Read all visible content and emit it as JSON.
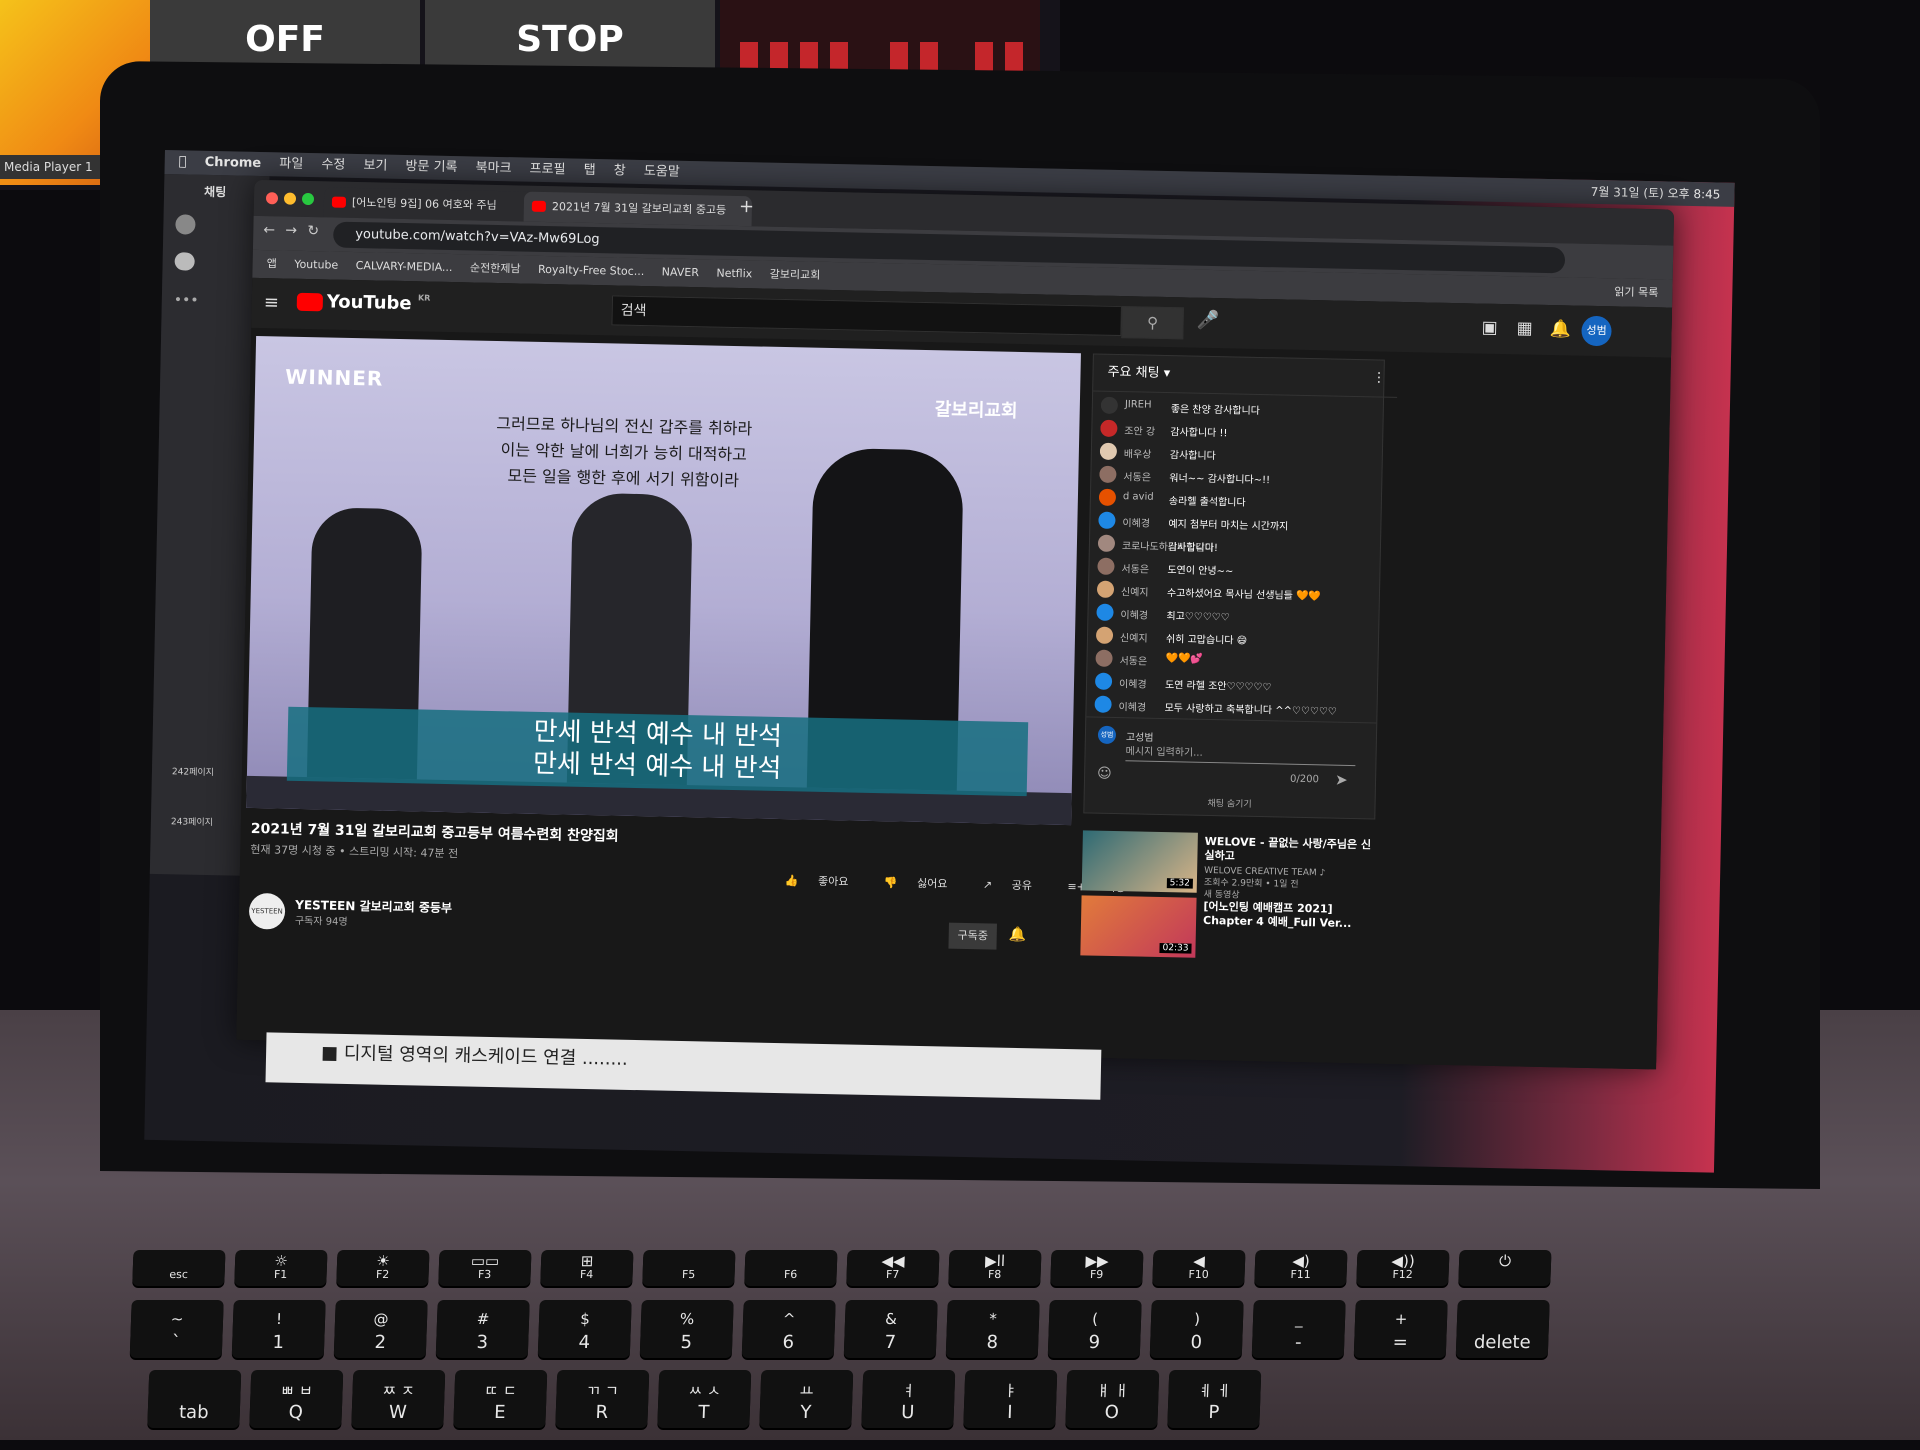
{
  "background": {
    "monitor_tiles": [
      {
        "label": "OFF"
      },
      {
        "label": "STOP"
      }
    ],
    "media_player_label": "Media Player 1"
  },
  "mac_menubar": {
    "app": "Chrome",
    "menus": [
      "파일",
      "수정",
      "보기",
      "방문 기록",
      "북마크",
      "프로필",
      "탭",
      "창",
      "도움말"
    ],
    "datetime": "7월 31일 (토) 오후 8:45"
  },
  "messenger": {
    "title": "채팅",
    "doc_items": [
      "242페이지",
      "243페이지"
    ]
  },
  "chrome": {
    "tabs": [
      {
        "title": "[어노인팅 9집] 06 여호와 주님"
      },
      {
        "title": "2021년 7월 31일 갈보리교회 중고등"
      }
    ],
    "new_tab": "+",
    "url": "youtube.com/watch?v=VAz-Mw69Log",
    "bookmarks": [
      "앱",
      "Youtube",
      "CALVARY-MEDIA...",
      "순전한제남",
      "Royalty-Free Stoc...",
      "NAVER",
      "Netflix",
      "갈보리교회"
    ],
    "reading_list": "읽기 목록"
  },
  "youtube": {
    "logo": "YouTube",
    "region": "KR",
    "search_placeholder": "검색",
    "user_initial": "성범",
    "video": {
      "overlay_logo": "WINNER",
      "church_logo": "갈보리교회",
      "verse_lines": [
        "그러므로 하나님의 전신 갑주를 취하라",
        "이는 악한 날에 너희가 능히 대적하고",
        "모든 일을 행한 후에 서기 위함이라"
      ],
      "lyric_lines": [
        "만세 반석 예수 내 반석",
        "만세 반석 예수 내 반석"
      ]
    },
    "title": "2021년 7월 31일 갈보리교회 중고등부 여름수련회 찬양집회",
    "meta": "현재 37명 시청 중 • 스트리밍 시작: 47분 전",
    "actions": [
      "좋아요",
      "싫어요",
      "공유",
      "저장"
    ],
    "channel": {
      "name": "YESTEEN 갈보리교회 중등부",
      "subscribers": "구독자 94명",
      "avatar_text": "YESTEEN",
      "subscribed_label": "구독중"
    },
    "chat": {
      "header": "주요 채팅",
      "messages": [
        {
          "name": "JIREH",
          "text": "좋은 찬양 감사합니다",
          "color": "#333333"
        },
        {
          "name": "조안 강",
          "text": "감사합니다 !!",
          "color": "#c62828"
        },
        {
          "name": "배우상",
          "text": "감사합니다",
          "color": "#e0c9b0"
        },
        {
          "name": "서동은",
          "text": "워너~~ 감사합니다~!!",
          "color": "#8d6e63"
        },
        {
          "name": "d avid",
          "text": "송라헬 출석합니다",
          "color": "#e65100"
        },
        {
          "name": "이혜경",
          "text": "예지 첨부터 마치는 시간까지",
          "color": "#1e88e5"
        },
        {
          "name": "코로나도하늬바람같이",
          "text": "감사합니다!",
          "color": "#a1887f"
        },
        {
          "name": "서동은",
          "text": "도연이 안녕~~",
          "color": "#8d6e63"
        },
        {
          "name": "신예지",
          "text": "수고하셨어요 목사님 선생님들 🧡🧡",
          "color": "#d4a373"
        },
        {
          "name": "이혜경",
          "text": "최고♡♡♡♡♡",
          "color": "#1e88e5"
        },
        {
          "name": "신예지",
          "text": "쉬히 고맙습니다 😄",
          "color": "#d4a373"
        },
        {
          "name": "서동은",
          "text": "🧡🧡💕",
          "color": "#8d6e63"
        },
        {
          "name": "이혜경",
          "text": "도연 라헬 조안♡♡♡♡♡",
          "color": "#1e88e5"
        },
        {
          "name": "이혜경",
          "text": "모두 사랑하고 축복합니다 ^^♡♡♡♡♡",
          "color": "#1e88e5"
        }
      ],
      "my_name": "고성범",
      "input_placeholder": "메시지 입력하기...",
      "counter": "0/200",
      "hide_chat": "채팅 숨기기"
    },
    "recommendations": [
      {
        "title": "WELOVE - 끝없는 사랑/주님은 신실하고",
        "channel": "WELOVE CREATIVE TEAM ♪",
        "meta": "조회수 2.9만회 • 1일 전",
        "badge": "새 동영상",
        "duration": "5:32"
      },
      {
        "title": "[어노인팅 예배캠프 2021] Chapter 4 예배_Full Ver...",
        "channel": "",
        "meta": "",
        "badge": "",
        "duration": "02:33"
      }
    ]
  },
  "document_strip": "■ 디지털 영역의 캐스케이드 연결 ........",
  "keyboard": {
    "fn_row": [
      {
        "top": "",
        "bottom": "esc"
      },
      {
        "top": "☼",
        "bottom": "F1"
      },
      {
        "top": "☀",
        "bottom": "F2"
      },
      {
        "top": "▭▭",
        "bottom": "F3"
      },
      {
        "top": "⊞",
        "bottom": "F4"
      },
      {
        "top": "",
        "bottom": "F5"
      },
      {
        "top": "",
        "bottom": "F6"
      },
      {
        "top": "◀◀",
        "bottom": "F7"
      },
      {
        "top": "▶ll",
        "bottom": "F8"
      },
      {
        "top": "▶▶",
        "bottom": "F9"
      },
      {
        "top": "◀",
        "bottom": "F10"
      },
      {
        "top": "◀)",
        "bottom": "F11"
      },
      {
        "top": "◀))",
        "bottom": "F12"
      },
      {
        "top": "⏻",
        "bottom": ""
      }
    ],
    "num_row": [
      {
        "top": "~",
        "bottom": "`"
      },
      {
        "top": "!",
        "bottom": "1"
      },
      {
        "top": "@",
        "bottom": "2"
      },
      {
        "top": "#",
        "bottom": "3"
      },
      {
        "top": "$",
        "bottom": "4"
      },
      {
        "top": "%",
        "bottom": "5"
      },
      {
        "top": "^",
        "bottom": "6"
      },
      {
        "top": "&",
        "bottom": "7"
      },
      {
        "top": "*",
        "bottom": "8"
      },
      {
        "top": "(",
        "bottom": "9"
      },
      {
        "top": ")",
        "bottom": "0"
      },
      {
        "top": "_",
        "bottom": "-"
      },
      {
        "top": "+",
        "bottom": "="
      },
      {
        "top": "",
        "bottom": "delete"
      }
    ],
    "q_row": [
      {
        "top": "",
        "bottom": "tab"
      },
      {
        "top": "ㅃ ㅂ",
        "bottom": "Q"
      },
      {
        "top": "ㅉ ㅈ",
        "bottom": "W"
      },
      {
        "top": "ㄸ ㄷ",
        "bottom": "E"
      },
      {
        "top": "ㄲ ㄱ",
        "bottom": "R"
      },
      {
        "top": "ㅆ ㅅ",
        "bottom": "T"
      },
      {
        "top": "ㅛ",
        "bottom": "Y"
      },
      {
        "top": "ㅕ",
        "bottom": "U"
      },
      {
        "top": "ㅑ",
        "bottom": "I"
      },
      {
        "top": "ㅒ ㅐ",
        "bottom": "O"
      },
      {
        "top": "ㅖ ㅔ",
        "bottom": "P"
      }
    ]
  }
}
